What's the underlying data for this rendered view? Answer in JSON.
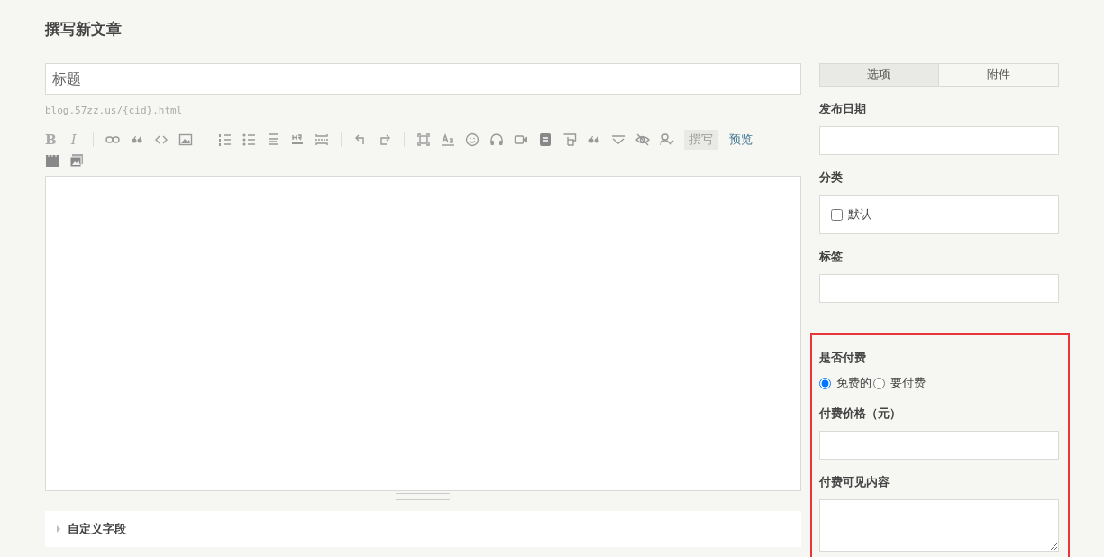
{
  "page_title": "撰写新文章",
  "title_field": {
    "placeholder": "标题"
  },
  "url_hint": "blog.57zz.us/{cid}.html",
  "format_buttons": [
    {
      "label": "B",
      "kind": "bold"
    },
    {
      "label": "I",
      "kind": "italic"
    }
  ],
  "editor_modes": [
    {
      "label": "撰写",
      "selected": true
    },
    {
      "label": "预览",
      "selected": false
    }
  ],
  "custom_fields": {
    "label": "自定义字段",
    "expanded": false
  },
  "side_tabs": [
    {
      "label": "选项",
      "selected": true
    },
    {
      "label": "附件",
      "selected": false
    }
  ],
  "publish_date": {
    "label": "发布日期"
  },
  "category": {
    "label": "分类",
    "options": [
      {
        "label": "默认",
        "checked": false
      }
    ]
  },
  "tags": {
    "label": "标签"
  },
  "payment": {
    "label": "是否付费",
    "options": [
      {
        "label": "免费的",
        "selected": true
      },
      {
        "label": "要付费",
        "selected": false
      }
    ]
  },
  "price": {
    "label": "付费价格（元）"
  },
  "paid_content": {
    "label": "付费可见内容"
  }
}
